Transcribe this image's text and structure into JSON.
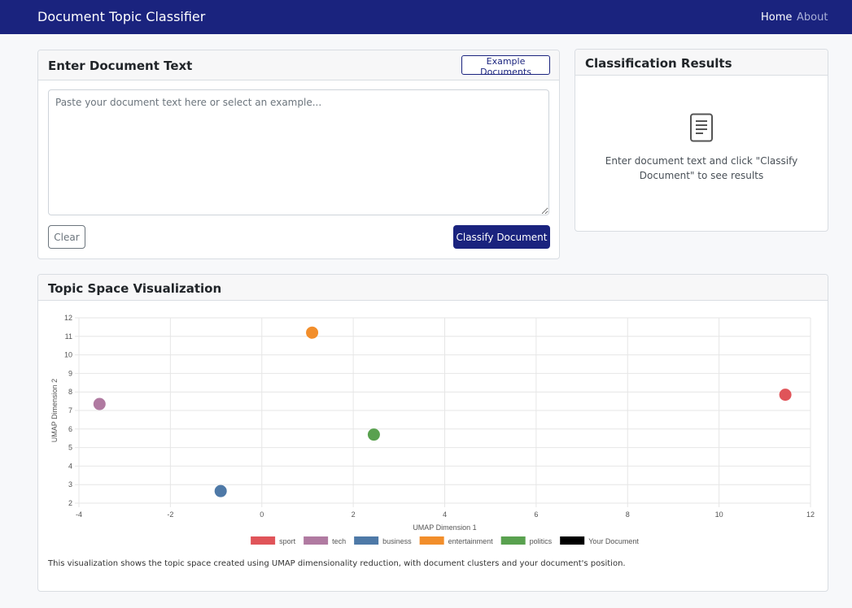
{
  "navbar": {
    "brand": "Document Topic Classifier",
    "links": [
      {
        "label": "Home",
        "active": true
      },
      {
        "label": "About",
        "active": false
      }
    ],
    "color": "#1a237e"
  },
  "input_card": {
    "title": "Enter Document Text",
    "examples_button": "Example Documents",
    "textarea_value": "",
    "textarea_placeholder": "Paste your document text here or select an example...",
    "clear_button": "Clear",
    "classify_button": "Classify Document"
  },
  "results_card": {
    "title": "Classification Results",
    "icon": "document-icon",
    "message": "Enter document text and click \"Classify Document\" to see results"
  },
  "viz_card": {
    "title": "Topic Space Visualization",
    "caption": "This visualization shows the topic space created using UMAP dimensionality reduction, with document clusters and your document's position."
  },
  "chart_data": {
    "type": "scatter",
    "xlabel": "UMAP Dimension 1",
    "ylabel": "UMAP Dimension 2",
    "xlim": [
      -4,
      12
    ],
    "ylim": [
      2,
      12
    ],
    "x_ticks": [
      -4,
      -2,
      0,
      2,
      4,
      6,
      8,
      10,
      12
    ],
    "y_ticks": [
      2,
      3,
      4,
      5,
      6,
      7,
      8,
      9,
      10,
      11,
      12
    ],
    "grid": true,
    "legend_position": "bottom",
    "series": [
      {
        "name": "sport",
        "color": "#e05459",
        "points": [
          {
            "x": 11.45,
            "y": 7.85
          }
        ]
      },
      {
        "name": "tech",
        "color": "#b07aa1",
        "points": [
          {
            "x": -3.55,
            "y": 7.35
          }
        ]
      },
      {
        "name": "business",
        "color": "#4e79a7",
        "points": [
          {
            "x": -0.9,
            "y": 2.65
          }
        ]
      },
      {
        "name": "entertainment",
        "color": "#f28e2b",
        "points": [
          {
            "x": 1.1,
            "y": 11.2
          }
        ]
      },
      {
        "name": "politics",
        "color": "#59a14f",
        "points": [
          {
            "x": 2.45,
            "y": 5.7
          }
        ]
      },
      {
        "name": "Your Document",
        "color": "#000000",
        "points": []
      }
    ]
  }
}
